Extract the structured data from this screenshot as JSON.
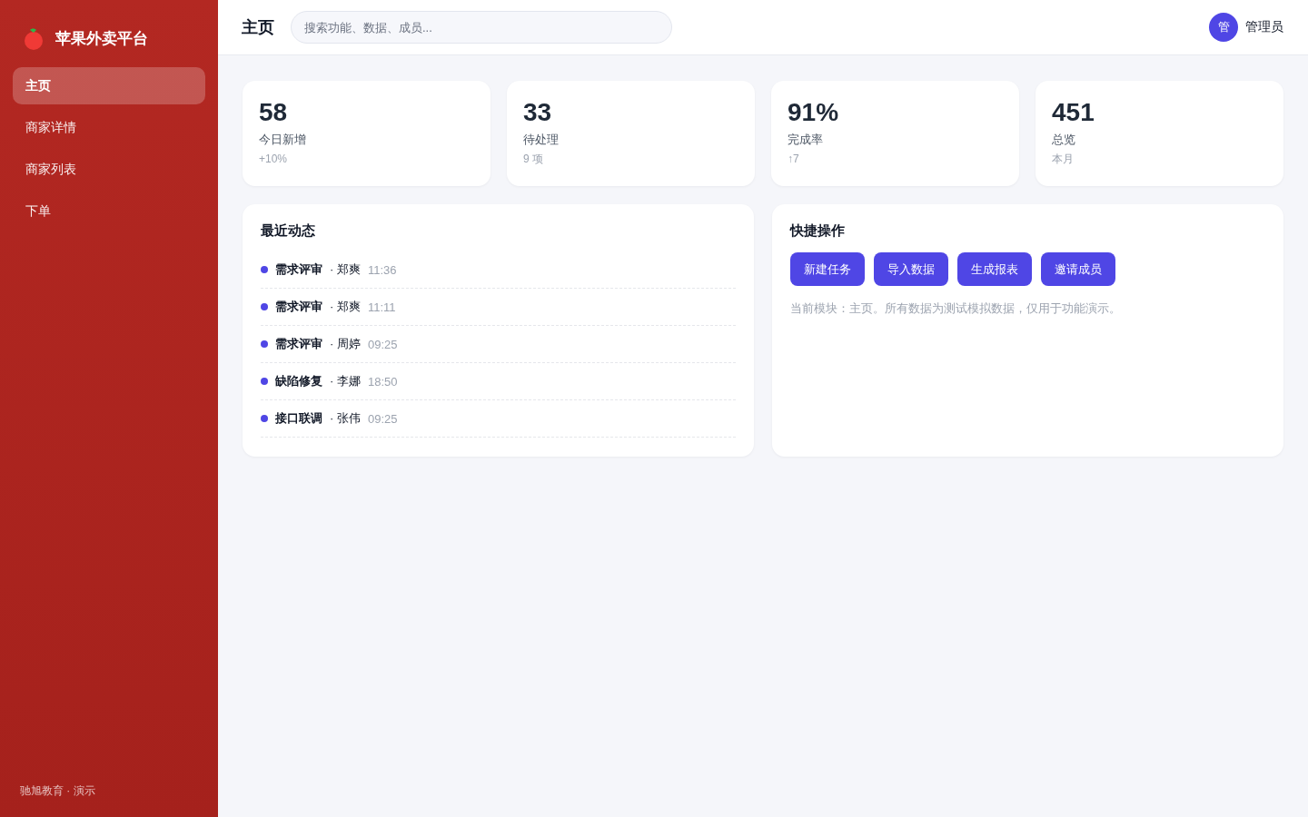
{
  "sidebar": {
    "brand": "苹果外卖平台",
    "items": [
      {
        "label": "主页",
        "selected": true
      },
      {
        "label": "商家详情",
        "selected": false
      },
      {
        "label": "商家列表",
        "selected": false
      },
      {
        "label": "下单",
        "selected": false
      }
    ],
    "footer": "驰旭教育 · 演示"
  },
  "header": {
    "title": "主页",
    "search": {
      "placeholder": "搜索功能、数据、成员..."
    },
    "user": {
      "avatar": "管",
      "name": "管理员"
    }
  },
  "stats": [
    {
      "value": "58",
      "label": "今日新增",
      "note": "+10%"
    },
    {
      "value": "33",
      "label": "待处理",
      "note": "9 项"
    },
    {
      "value": "91%",
      "label": "完成率",
      "note": "↑7"
    },
    {
      "value": "451",
      "label": "总览",
      "note": "本月"
    }
  ],
  "activity": {
    "title": "最近动态",
    "items": [
      {
        "title": "需求评审",
        "person": "· 郑爽",
        "time": "11:36"
      },
      {
        "title": "需求评审",
        "person": "· 郑爽",
        "time": "11:11"
      },
      {
        "title": "需求评审",
        "person": "· 周婷",
        "time": "09:25"
      },
      {
        "title": "缺陷修复",
        "person": "· 李娜",
        "time": "18:50"
      },
      {
        "title": "接口联调",
        "person": "· 张伟",
        "time": "09:25"
      }
    ]
  },
  "quick_actions": {
    "title": "快捷操作",
    "buttons": [
      "新建任务",
      "导入数据",
      "生成报表",
      "邀请成员"
    ],
    "note": "当前模块：主页。所有数据为测试模拟数据，仅用于功能演示。"
  }
}
